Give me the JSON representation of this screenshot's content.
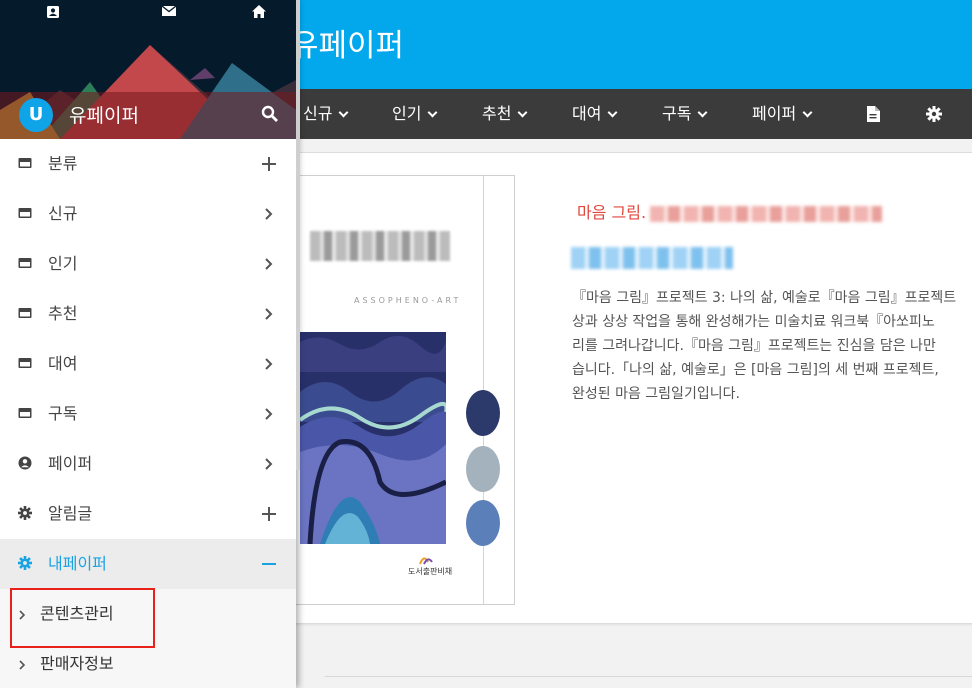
{
  "topbar": {
    "brand": "유페이퍼"
  },
  "navbar": {
    "items": [
      {
        "label": "신규"
      },
      {
        "label": "인기"
      },
      {
        "label": "추천"
      },
      {
        "label": "대여"
      },
      {
        "label": "구독"
      },
      {
        "label": "페이퍼"
      }
    ],
    "icons": [
      "document-icon",
      "gear-icon"
    ]
  },
  "drawer": {
    "header_icons": [
      "contact-icon",
      "mail-icon",
      "home-icon"
    ],
    "avatar_letter": "U",
    "title": "유페이퍼",
    "search_icon": "search-icon",
    "items": [
      {
        "label": "분류",
        "icon": "card-icon",
        "right": "plus"
      },
      {
        "label": "신규",
        "icon": "card-icon",
        "right": "chevron"
      },
      {
        "label": "인기",
        "icon": "card-icon",
        "right": "chevron"
      },
      {
        "label": "추천",
        "icon": "card-icon",
        "right": "chevron"
      },
      {
        "label": "대여",
        "icon": "card-icon",
        "right": "chevron"
      },
      {
        "label": "구독",
        "icon": "card-icon",
        "right": "chevron"
      },
      {
        "label": "페이퍼",
        "icon": "person-icon",
        "right": "chevron"
      },
      {
        "label": "알림글",
        "icon": "gear-icon",
        "right": "plus"
      },
      {
        "label": "내페이퍼",
        "icon": "gear-icon",
        "right": "minus",
        "active": true
      }
    ],
    "sub_items": [
      {
        "label": "콘텐츠관리"
      },
      {
        "label": "판매자정보"
      }
    ]
  },
  "book": {
    "category": "마음 그림.",
    "cover_subtitle": "ASSOPHENO-ART",
    "publisher": "도서출판비채",
    "description_lines": [
      "『마음 그림』프로젝트 3: 나의 삶, 예술로『마음 그림』프로젝트",
      "상과 상상 작업을 통해 완성해가는 미술치료 워크북『아쏘피노",
      "리를 그려나갑니다.『마음 그림』프로젝트는 진심을 담은 나만",
      "습니다.「나의 삶, 예술로」은 [마음 그림]의 세 번째 프로젝트,",
      "완성된 마음 그림일기입니다."
    ]
  },
  "colors": {
    "topbar": "#02a7ec",
    "navbar": "#3b3b3b",
    "accent": "#1aa3e3",
    "category_red": "#e0473d",
    "highlight": "#e8211b",
    "swatches": [
      "#2c3a6b",
      "#a3b2bd",
      "#5b7fb8"
    ]
  }
}
